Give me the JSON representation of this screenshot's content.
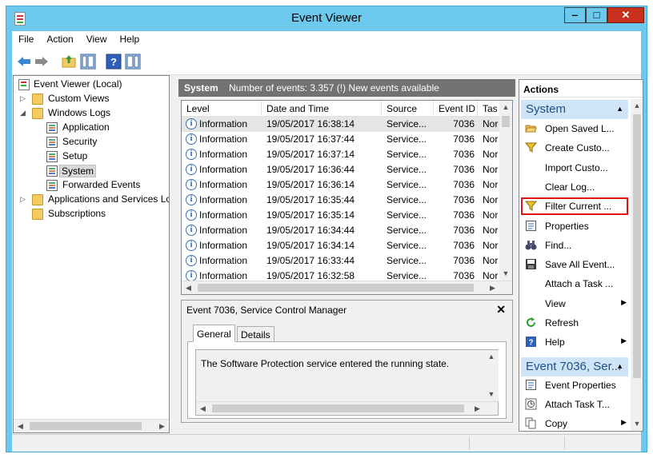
{
  "window": {
    "title": "Event Viewer",
    "controls": {
      "minimize": "‒",
      "maximize": "□",
      "close": "✕"
    }
  },
  "menu": [
    "File",
    "Action",
    "View",
    "Help"
  ],
  "toolbar": {
    "icons": [
      "back-arrow-icon",
      "forward-arrow-icon",
      "up-folder-icon",
      "show-hide-tree-icon",
      "help-icon",
      "properties-pane-icon"
    ]
  },
  "tree": {
    "root": "Event Viewer (Local)",
    "custom_views": "Custom Views",
    "windows_logs": "Windows Logs",
    "logs": [
      "Application",
      "Security",
      "Setup",
      "System",
      "Forwarded Events"
    ],
    "apps_services": "Applications and Services Lo",
    "subscriptions": "Subscriptions",
    "selected": "System"
  },
  "center": {
    "log_name": "System",
    "count_text": "Number of events: 3.357 (!) New events available",
    "columns": [
      "Level",
      "Date and Time",
      "Source",
      "Event ID",
      "Tas"
    ],
    "rows": [
      {
        "level": "Information",
        "date": "19/05/2017 16:38:14",
        "source": "Service...",
        "id": "7036",
        "task": "Nor"
      },
      {
        "level": "Information",
        "date": "19/05/2017 16:37:44",
        "source": "Service...",
        "id": "7036",
        "task": "Nor"
      },
      {
        "level": "Information",
        "date": "19/05/2017 16:37:14",
        "source": "Service...",
        "id": "7036",
        "task": "Nor"
      },
      {
        "level": "Information",
        "date": "19/05/2017 16:36:44",
        "source": "Service...",
        "id": "7036",
        "task": "Nor"
      },
      {
        "level": "Information",
        "date": "19/05/2017 16:36:14",
        "source": "Service...",
        "id": "7036",
        "task": "Nor"
      },
      {
        "level": "Information",
        "date": "19/05/2017 16:35:44",
        "source": "Service...",
        "id": "7036",
        "task": "Nor"
      },
      {
        "level": "Information",
        "date": "19/05/2017 16:35:14",
        "source": "Service...",
        "id": "7036",
        "task": "Nor"
      },
      {
        "level": "Information",
        "date": "19/05/2017 16:34:44",
        "source": "Service...",
        "id": "7036",
        "task": "Nor"
      },
      {
        "level": "Information",
        "date": "19/05/2017 16:34:14",
        "source": "Service...",
        "id": "7036",
        "task": "Nor"
      },
      {
        "level": "Information",
        "date": "19/05/2017 16:33:44",
        "source": "Service...",
        "id": "7036",
        "task": "Nor"
      },
      {
        "level": "Information",
        "date": "19/05/2017 16:32:58",
        "source": "Service...",
        "id": "7036",
        "task": "Nor"
      }
    ]
  },
  "detail": {
    "title": "Event 7036, Service Control Manager",
    "close": "✕",
    "tabs": [
      "General",
      "Details"
    ],
    "description": "The Software Protection service entered the running state."
  },
  "actions": {
    "header": "Actions",
    "system_section": "System",
    "system_items": [
      {
        "label": "Open Saved L...",
        "icon": "open-folder-icon"
      },
      {
        "label": "Create Custo...",
        "icon": "filter-icon"
      },
      {
        "label": "Import Custo...",
        "icon": ""
      },
      {
        "label": "Clear Log...",
        "icon": ""
      },
      {
        "label": "Filter Current ...",
        "icon": "filter-icon"
      },
      {
        "label": "Properties",
        "icon": "properties-icon"
      },
      {
        "label": "Find...",
        "icon": "binoculars-icon"
      },
      {
        "label": "Save All Event...",
        "icon": "save-icon"
      },
      {
        "label": "Attach a Task ...",
        "icon": ""
      },
      {
        "label": "View",
        "icon": ""
      },
      {
        "label": "Refresh",
        "icon": "refresh-icon"
      },
      {
        "label": "Help",
        "icon": "help-icon"
      }
    ],
    "event_section": "Event 7036, Ser...",
    "event_items": [
      {
        "label": "Event Properties",
        "icon": "properties-icon"
      },
      {
        "label": "Attach Task T...",
        "icon": "clock-task-icon"
      },
      {
        "label": "Copy",
        "icon": "copy-icon"
      }
    ],
    "highlighted": "Filter Current ..."
  },
  "colors": {
    "title_bar": "#6cc8ec",
    "close_button": "#c7311d",
    "highlight_border": "#e21515",
    "section_header_bg": "#cfe4f7",
    "center_header_bg": "#727272"
  }
}
